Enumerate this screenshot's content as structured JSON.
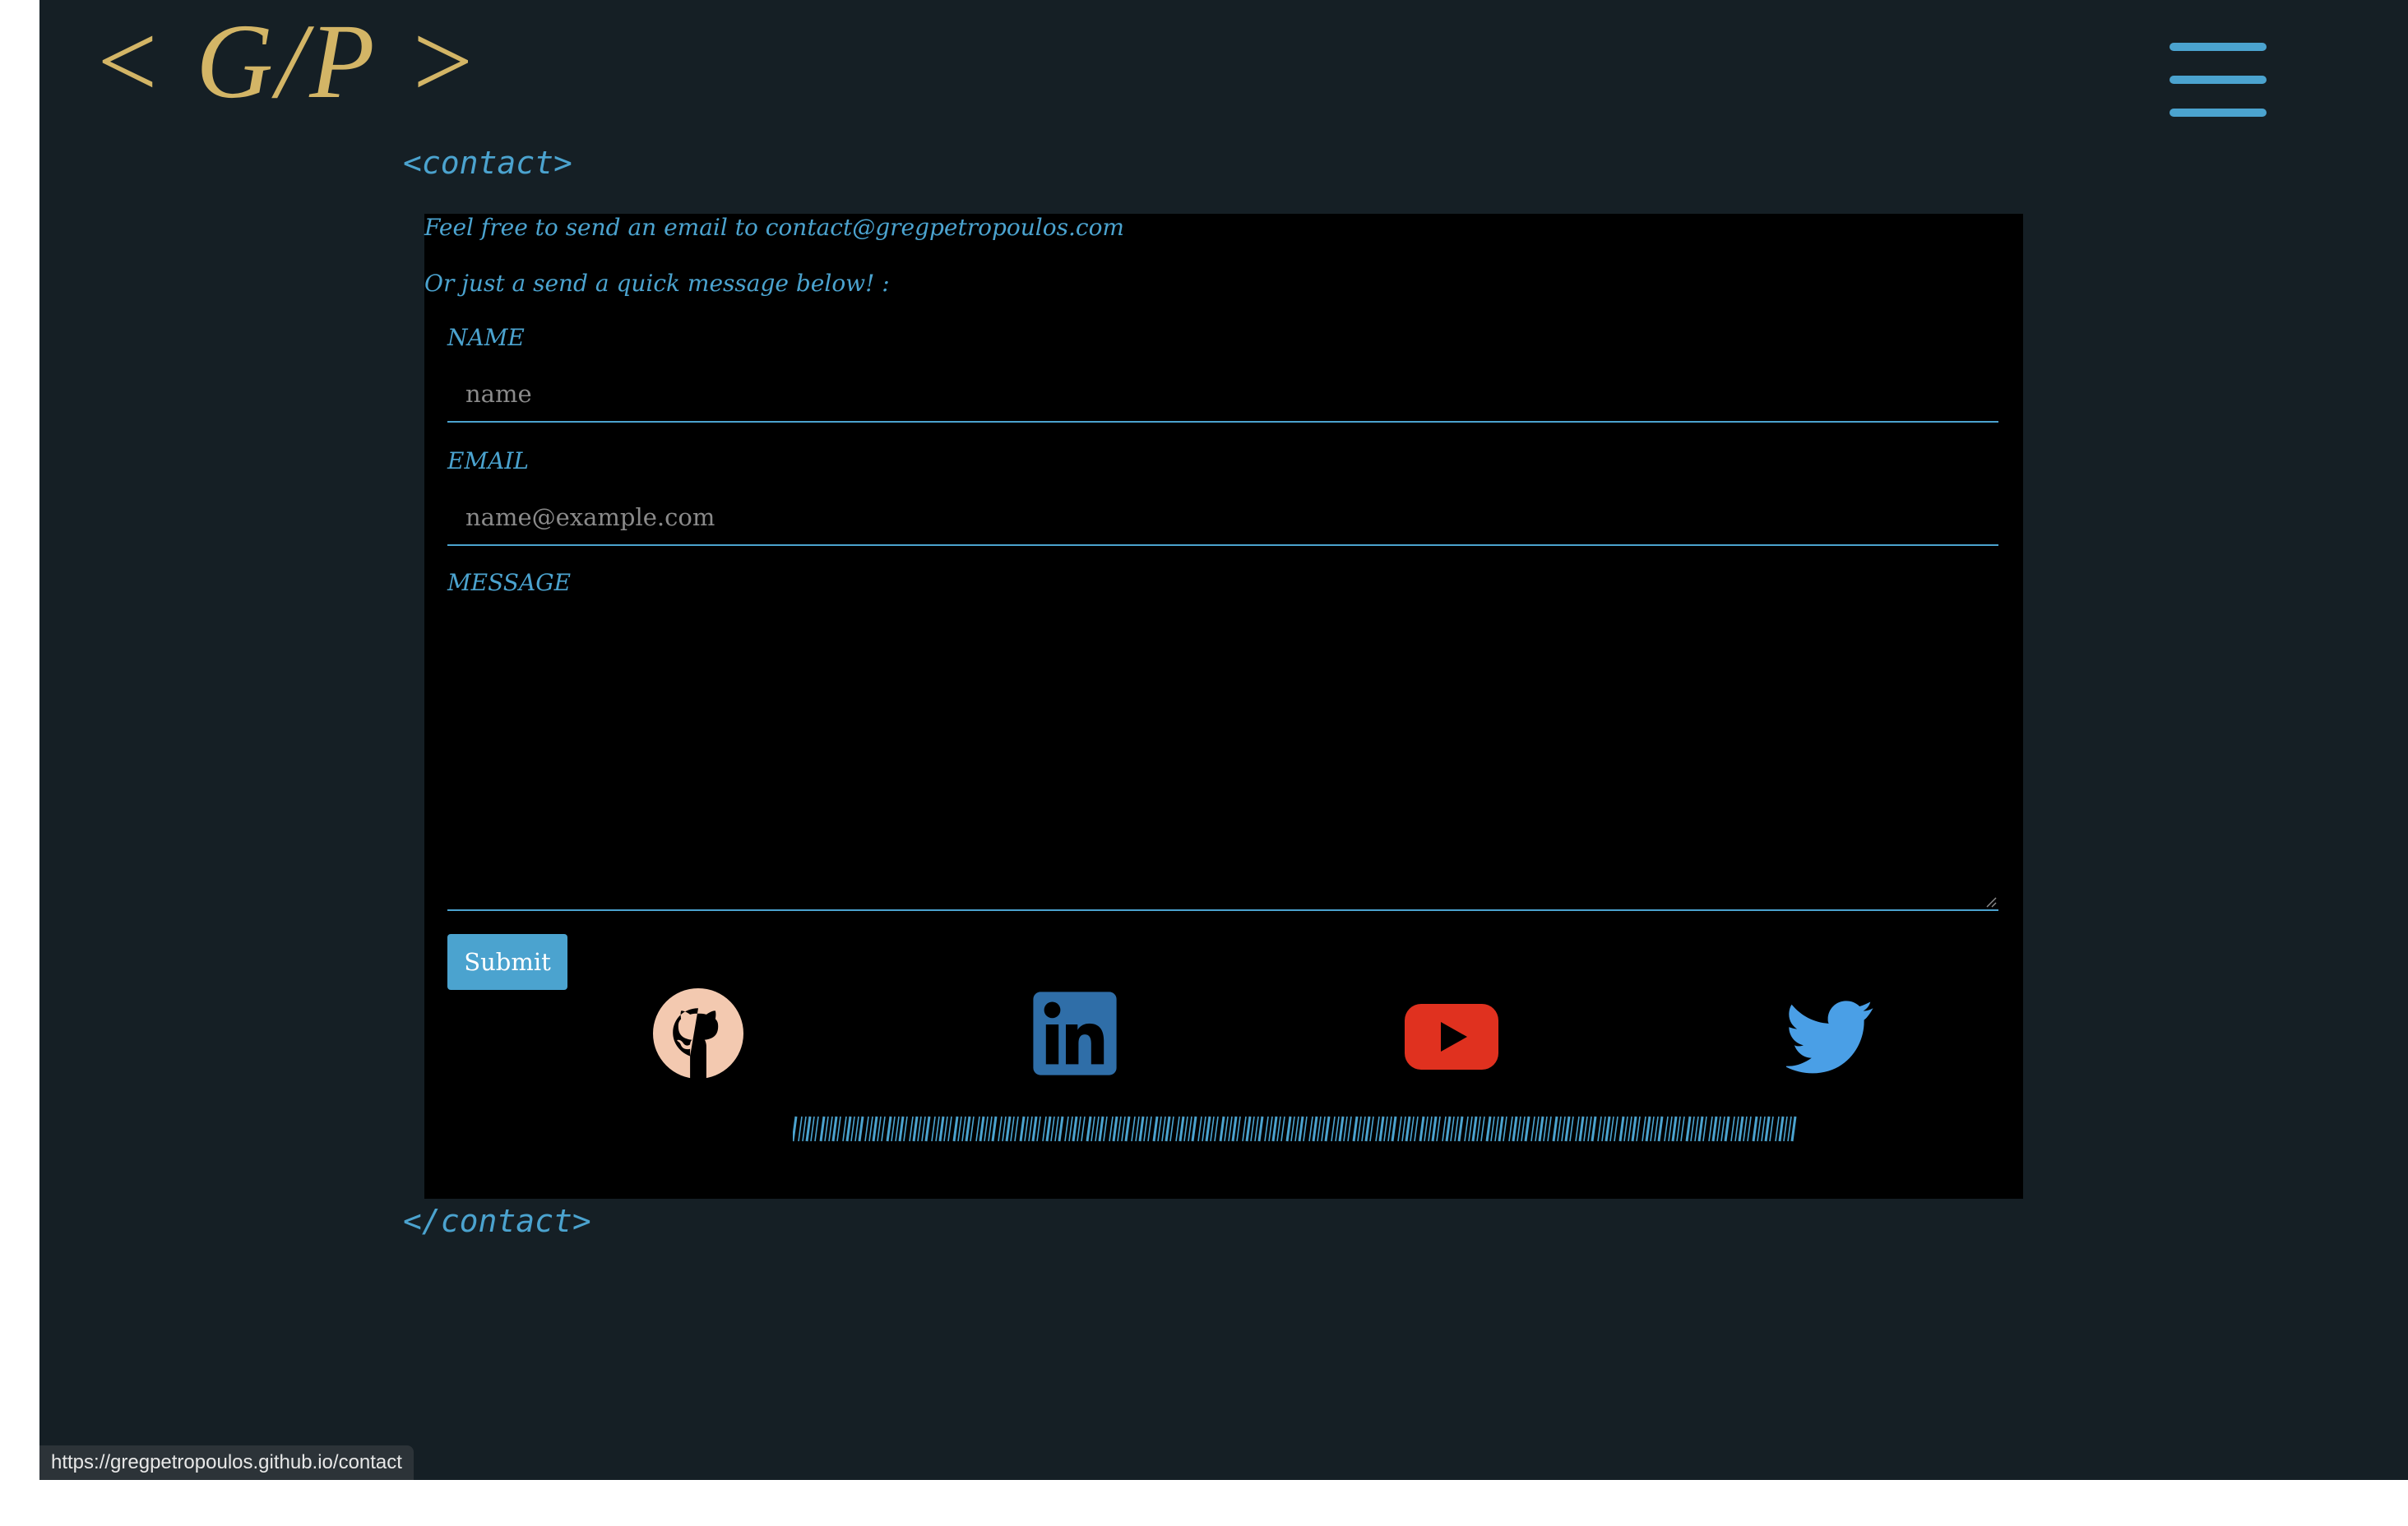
{
  "header": {
    "logo_text": "< G/P >",
    "menu_icon": "hamburger-menu-icon"
  },
  "contact": {
    "open_tag": "<contact>",
    "close_tag": "</contact>",
    "intro_line1": "Feel free to send an email to contact@gregpetropoulos.com",
    "intro_line2": "Or just a send a quick message below! :",
    "form": {
      "name_label": "NAME",
      "name_placeholder": "name",
      "name_value": "",
      "email_label": "EMAIL",
      "email_placeholder": "name@example.com",
      "email_value": "",
      "message_label": "MESSAGE",
      "message_value": "",
      "submit_label": "Submit"
    },
    "social_links": [
      {
        "name": "github",
        "icon": "github-icon",
        "color": "#f3c9b0"
      },
      {
        "name": "linkedin",
        "icon": "linkedin-icon",
        "color": "#2f6ea8"
      },
      {
        "name": "youtube",
        "icon": "youtube-icon",
        "color": "#e0311f"
      },
      {
        "name": "twitter",
        "icon": "twitter-icon",
        "color": "#4a9fe6"
      }
    ]
  },
  "status_bar": {
    "url": "https://gregpetropoulos.github.io/contact"
  },
  "colors": {
    "page_bg": "#151f25",
    "card_bg": "#000000",
    "accent": "#4ba3cf",
    "logo": "#d3b566"
  }
}
